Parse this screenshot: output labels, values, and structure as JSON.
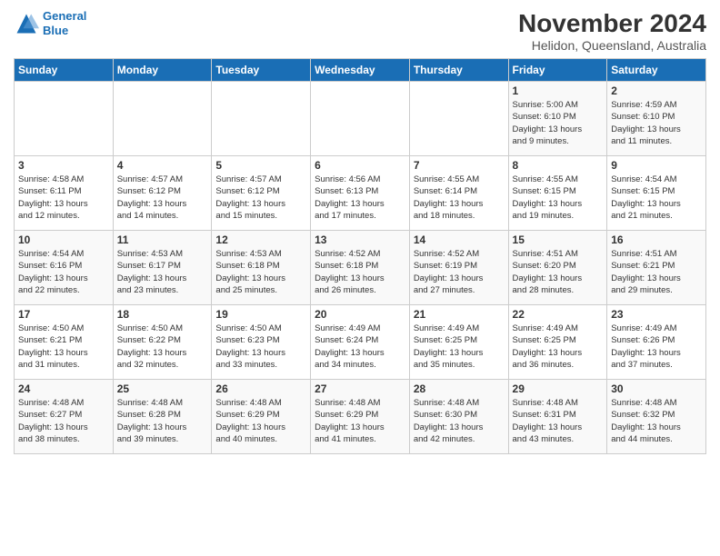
{
  "logo": {
    "line1": "General",
    "line2": "Blue"
  },
  "title": "November 2024",
  "location": "Helidon, Queensland, Australia",
  "days_header": [
    "Sunday",
    "Monday",
    "Tuesday",
    "Wednesday",
    "Thursday",
    "Friday",
    "Saturday"
  ],
  "weeks": [
    [
      {
        "day": "",
        "info": ""
      },
      {
        "day": "",
        "info": ""
      },
      {
        "day": "",
        "info": ""
      },
      {
        "day": "",
        "info": ""
      },
      {
        "day": "",
        "info": ""
      },
      {
        "day": "1",
        "info": "Sunrise: 5:00 AM\nSunset: 6:10 PM\nDaylight: 13 hours\nand 9 minutes."
      },
      {
        "day": "2",
        "info": "Sunrise: 4:59 AM\nSunset: 6:10 PM\nDaylight: 13 hours\nand 11 minutes."
      }
    ],
    [
      {
        "day": "3",
        "info": "Sunrise: 4:58 AM\nSunset: 6:11 PM\nDaylight: 13 hours\nand 12 minutes."
      },
      {
        "day": "4",
        "info": "Sunrise: 4:57 AM\nSunset: 6:12 PM\nDaylight: 13 hours\nand 14 minutes."
      },
      {
        "day": "5",
        "info": "Sunrise: 4:57 AM\nSunset: 6:12 PM\nDaylight: 13 hours\nand 15 minutes."
      },
      {
        "day": "6",
        "info": "Sunrise: 4:56 AM\nSunset: 6:13 PM\nDaylight: 13 hours\nand 17 minutes."
      },
      {
        "day": "7",
        "info": "Sunrise: 4:55 AM\nSunset: 6:14 PM\nDaylight: 13 hours\nand 18 minutes."
      },
      {
        "day": "8",
        "info": "Sunrise: 4:55 AM\nSunset: 6:15 PM\nDaylight: 13 hours\nand 19 minutes."
      },
      {
        "day": "9",
        "info": "Sunrise: 4:54 AM\nSunset: 6:15 PM\nDaylight: 13 hours\nand 21 minutes."
      }
    ],
    [
      {
        "day": "10",
        "info": "Sunrise: 4:54 AM\nSunset: 6:16 PM\nDaylight: 13 hours\nand 22 minutes."
      },
      {
        "day": "11",
        "info": "Sunrise: 4:53 AM\nSunset: 6:17 PM\nDaylight: 13 hours\nand 23 minutes."
      },
      {
        "day": "12",
        "info": "Sunrise: 4:53 AM\nSunset: 6:18 PM\nDaylight: 13 hours\nand 25 minutes."
      },
      {
        "day": "13",
        "info": "Sunrise: 4:52 AM\nSunset: 6:18 PM\nDaylight: 13 hours\nand 26 minutes."
      },
      {
        "day": "14",
        "info": "Sunrise: 4:52 AM\nSunset: 6:19 PM\nDaylight: 13 hours\nand 27 minutes."
      },
      {
        "day": "15",
        "info": "Sunrise: 4:51 AM\nSunset: 6:20 PM\nDaylight: 13 hours\nand 28 minutes."
      },
      {
        "day": "16",
        "info": "Sunrise: 4:51 AM\nSunset: 6:21 PM\nDaylight: 13 hours\nand 29 minutes."
      }
    ],
    [
      {
        "day": "17",
        "info": "Sunrise: 4:50 AM\nSunset: 6:21 PM\nDaylight: 13 hours\nand 31 minutes."
      },
      {
        "day": "18",
        "info": "Sunrise: 4:50 AM\nSunset: 6:22 PM\nDaylight: 13 hours\nand 32 minutes."
      },
      {
        "day": "19",
        "info": "Sunrise: 4:50 AM\nSunset: 6:23 PM\nDaylight: 13 hours\nand 33 minutes."
      },
      {
        "day": "20",
        "info": "Sunrise: 4:49 AM\nSunset: 6:24 PM\nDaylight: 13 hours\nand 34 minutes."
      },
      {
        "day": "21",
        "info": "Sunrise: 4:49 AM\nSunset: 6:25 PM\nDaylight: 13 hours\nand 35 minutes."
      },
      {
        "day": "22",
        "info": "Sunrise: 4:49 AM\nSunset: 6:25 PM\nDaylight: 13 hours\nand 36 minutes."
      },
      {
        "day": "23",
        "info": "Sunrise: 4:49 AM\nSunset: 6:26 PM\nDaylight: 13 hours\nand 37 minutes."
      }
    ],
    [
      {
        "day": "24",
        "info": "Sunrise: 4:48 AM\nSunset: 6:27 PM\nDaylight: 13 hours\nand 38 minutes."
      },
      {
        "day": "25",
        "info": "Sunrise: 4:48 AM\nSunset: 6:28 PM\nDaylight: 13 hours\nand 39 minutes."
      },
      {
        "day": "26",
        "info": "Sunrise: 4:48 AM\nSunset: 6:29 PM\nDaylight: 13 hours\nand 40 minutes."
      },
      {
        "day": "27",
        "info": "Sunrise: 4:48 AM\nSunset: 6:29 PM\nDaylight: 13 hours\nand 41 minutes."
      },
      {
        "day": "28",
        "info": "Sunrise: 4:48 AM\nSunset: 6:30 PM\nDaylight: 13 hours\nand 42 minutes."
      },
      {
        "day": "29",
        "info": "Sunrise: 4:48 AM\nSunset: 6:31 PM\nDaylight: 13 hours\nand 43 minutes."
      },
      {
        "day": "30",
        "info": "Sunrise: 4:48 AM\nSunset: 6:32 PM\nDaylight: 13 hours\nand 44 minutes."
      }
    ]
  ]
}
